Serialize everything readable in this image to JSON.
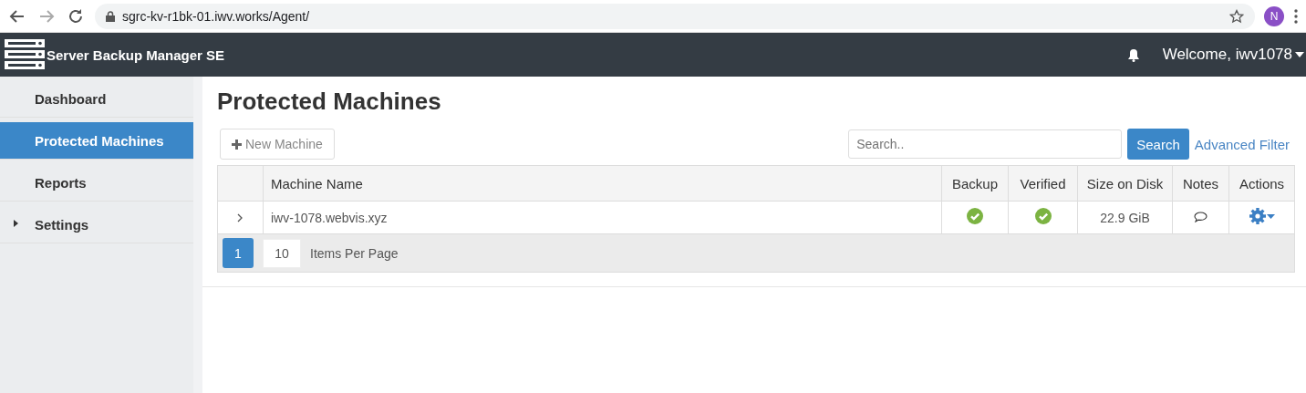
{
  "browser": {
    "url": "sgrc-kv-r1bk-01.iwv.works/Agent/",
    "profile_initial": "N"
  },
  "app": {
    "title": "Server Backup Manager SE",
    "welcome": "Welcome, iwv1078"
  },
  "sidebar": {
    "items": [
      {
        "label": "Dashboard",
        "selected": false,
        "expandable": false
      },
      {
        "label": "Protected Machines",
        "selected": true,
        "expandable": false
      },
      {
        "label": "Reports",
        "selected": false,
        "expandable": false
      },
      {
        "label": "Settings",
        "selected": false,
        "expandable": true
      }
    ]
  },
  "page": {
    "title": "Protected Machines",
    "new_button": "New Machine",
    "search": {
      "placeholder": "Search.."
    },
    "search_button": "Search",
    "advanced_filter": "Advanced Filter"
  },
  "table": {
    "columns": [
      "Machine Name",
      "Backup",
      "Verified",
      "Size on Disk",
      "Notes",
      "Actions"
    ],
    "rows": [
      {
        "name": "iwv-1078.webvis.xyz",
        "backup": true,
        "verified": true,
        "size": "22.9 GiB"
      }
    ]
  },
  "pager": {
    "pages": [
      {
        "label": "1",
        "selected": true
      }
    ],
    "page_size": "10",
    "page_size_label": "Items Per Page"
  }
}
